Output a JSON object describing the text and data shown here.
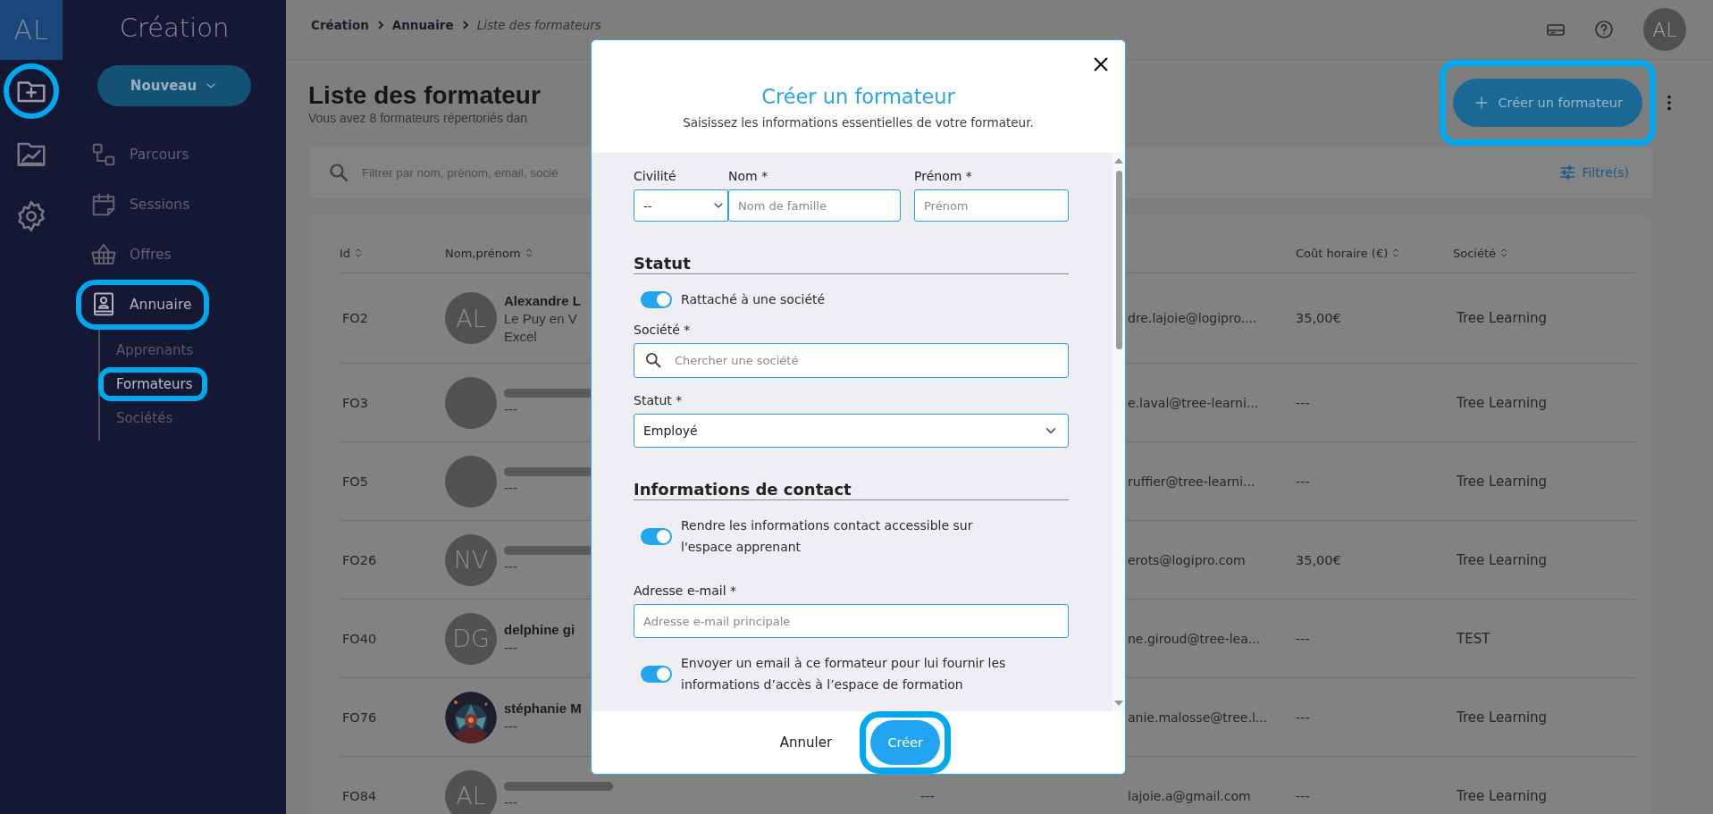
{
  "rail": {
    "logo": "AL",
    "items": [
      {
        "kind": "folder-plus",
        "selected": true,
        "highlighted": true
      },
      {
        "kind": "chart",
        "selected": false,
        "highlighted": false
      },
      {
        "kind": "settings",
        "selected": false,
        "highlighted": false
      }
    ]
  },
  "sidebar": {
    "title": "Création",
    "new_button": "Nouveau",
    "items": [
      {
        "kind": "path",
        "label": "Parcours",
        "selected": false,
        "highlighted": false
      },
      {
        "kind": "calendar",
        "label": "Sessions",
        "selected": false,
        "highlighted": false
      },
      {
        "kind": "basket",
        "label": "Offres",
        "selected": false,
        "highlighted": false
      },
      {
        "kind": "contacts",
        "label": "Annuaire",
        "selected": true,
        "highlighted": true,
        "children": [
          {
            "label": "Apprenants",
            "selected": false,
            "highlighted": false
          },
          {
            "label": "Formateurs",
            "selected": true,
            "highlighted": true
          },
          {
            "label": "Sociétés",
            "selected": false,
            "highlighted": false
          }
        ]
      }
    ]
  },
  "breadcrumb": [
    {
      "label": "Création",
      "current": false
    },
    {
      "label": "Annuaire",
      "current": false
    },
    {
      "label": "Liste des formateurs",
      "current": true
    }
  ],
  "header": {
    "avatar": "AL"
  },
  "page": {
    "title": "Liste des formateur",
    "subtitle": "Vous avez 8 formateurs répertoriés dan",
    "create_button": {
      "label": "Créer un formateur",
      "highlighted": true
    }
  },
  "filter": {
    "placeholder": "Filtrer par nom, prénom, email, socié",
    "button": "Filtre(s)"
  },
  "table": {
    "columns": [
      {
        "label": "Id"
      },
      {
        "label": "Nom,prénom"
      },
      {
        "label": "Coût horaire (€)"
      },
      {
        "label": "Société"
      }
    ],
    "rows": [
      {
        "id": "FO2",
        "avatar": {
          "kind": "initials",
          "text": "AL"
        },
        "name": "Alexandre L",
        "redacted": false,
        "details": [
          "Le Puy en V",
          "Excel"
        ],
        "email": "dre.lajoie@logipro....",
        "rate": "35,00€",
        "company": "Tree Learning"
      },
      {
        "id": "FO3",
        "avatar": {
          "kind": "blank"
        },
        "redacted": true,
        "details": [
          "---"
        ],
        "email": "e.laval@tree-learni...",
        "rate": "---",
        "company": "Tree Learning"
      },
      {
        "id": "FO5",
        "avatar": {
          "kind": "blank"
        },
        "redacted": true,
        "details": [
          "---"
        ],
        "email": "ruffier@tree-learni...",
        "rate": "---",
        "company": "Tree Learning"
      },
      {
        "id": "FO26",
        "avatar": {
          "kind": "initials",
          "text": "NV"
        },
        "redacted": true,
        "details": [
          "---"
        ],
        "email": "erots@logipro.com",
        "rate": "35,00€",
        "company": "Tree Learning"
      },
      {
        "id": "FO40",
        "avatar": {
          "kind": "initials",
          "text": "DG"
        },
        "name": "delphine gi",
        "redacted": false,
        "details": [
          "---"
        ],
        "email": "ne.giroud@tree-lea...",
        "rate": "---",
        "company": "TEST"
      },
      {
        "id": "FO76",
        "avatar": {
          "kind": "picture"
        },
        "name": "stéphanie M",
        "redacted": false,
        "details": [
          "---"
        ],
        "email": "anie.malosse@tree.l...",
        "rate": "---",
        "company": "Tree Learning"
      },
      {
        "id": "FO84",
        "avatar": {
          "kind": "initials",
          "text": "AL"
        },
        "redacted": true,
        "details": [
          "---"
        ],
        "column_3": "---",
        "email": "lajoie.a@gmail.com",
        "rate": "---",
        "company": "Tree Learning"
      }
    ]
  },
  "modal": {
    "title": "Créer un formateur",
    "subtitle": "Saisissez les informations essentielles de votre formateur.",
    "name_row": {
      "civility": {
        "label": "Civilité",
        "value": "--"
      },
      "last_name": {
        "label": "Nom *",
        "placeholder": "Nom de famille"
      },
      "first_name": {
        "label": "Prénom *",
        "placeholder": "Prénom"
      }
    },
    "sections": [
      {
        "heading": "Statut",
        "items": [
          {
            "kind": "toggle",
            "label": "Rattaché à une société",
            "on": true
          },
          {
            "kind": "search",
            "label": "Société *",
            "placeholder": "Chercher une société"
          },
          {
            "kind": "select",
            "label": "Statut *",
            "value": "Employé"
          }
        ]
      },
      {
        "heading": "Informations de contact",
        "items": [
          {
            "kind": "toggle",
            "label": "Rendre les informations contact accessible sur l'espace apprenant",
            "on": true
          },
          {
            "kind": "input",
            "label": "Adresse e-mail *",
            "placeholder": "Adresse e-mail principale"
          },
          {
            "kind": "toggle",
            "label": "Envoyer un email à ce formateur pour lui fournir les informations d’accès à l’espace de formation",
            "on": true
          }
        ]
      }
    ],
    "cancel": "Annuler",
    "submit": {
      "label": "Créer",
      "highlighted": true
    }
  }
}
